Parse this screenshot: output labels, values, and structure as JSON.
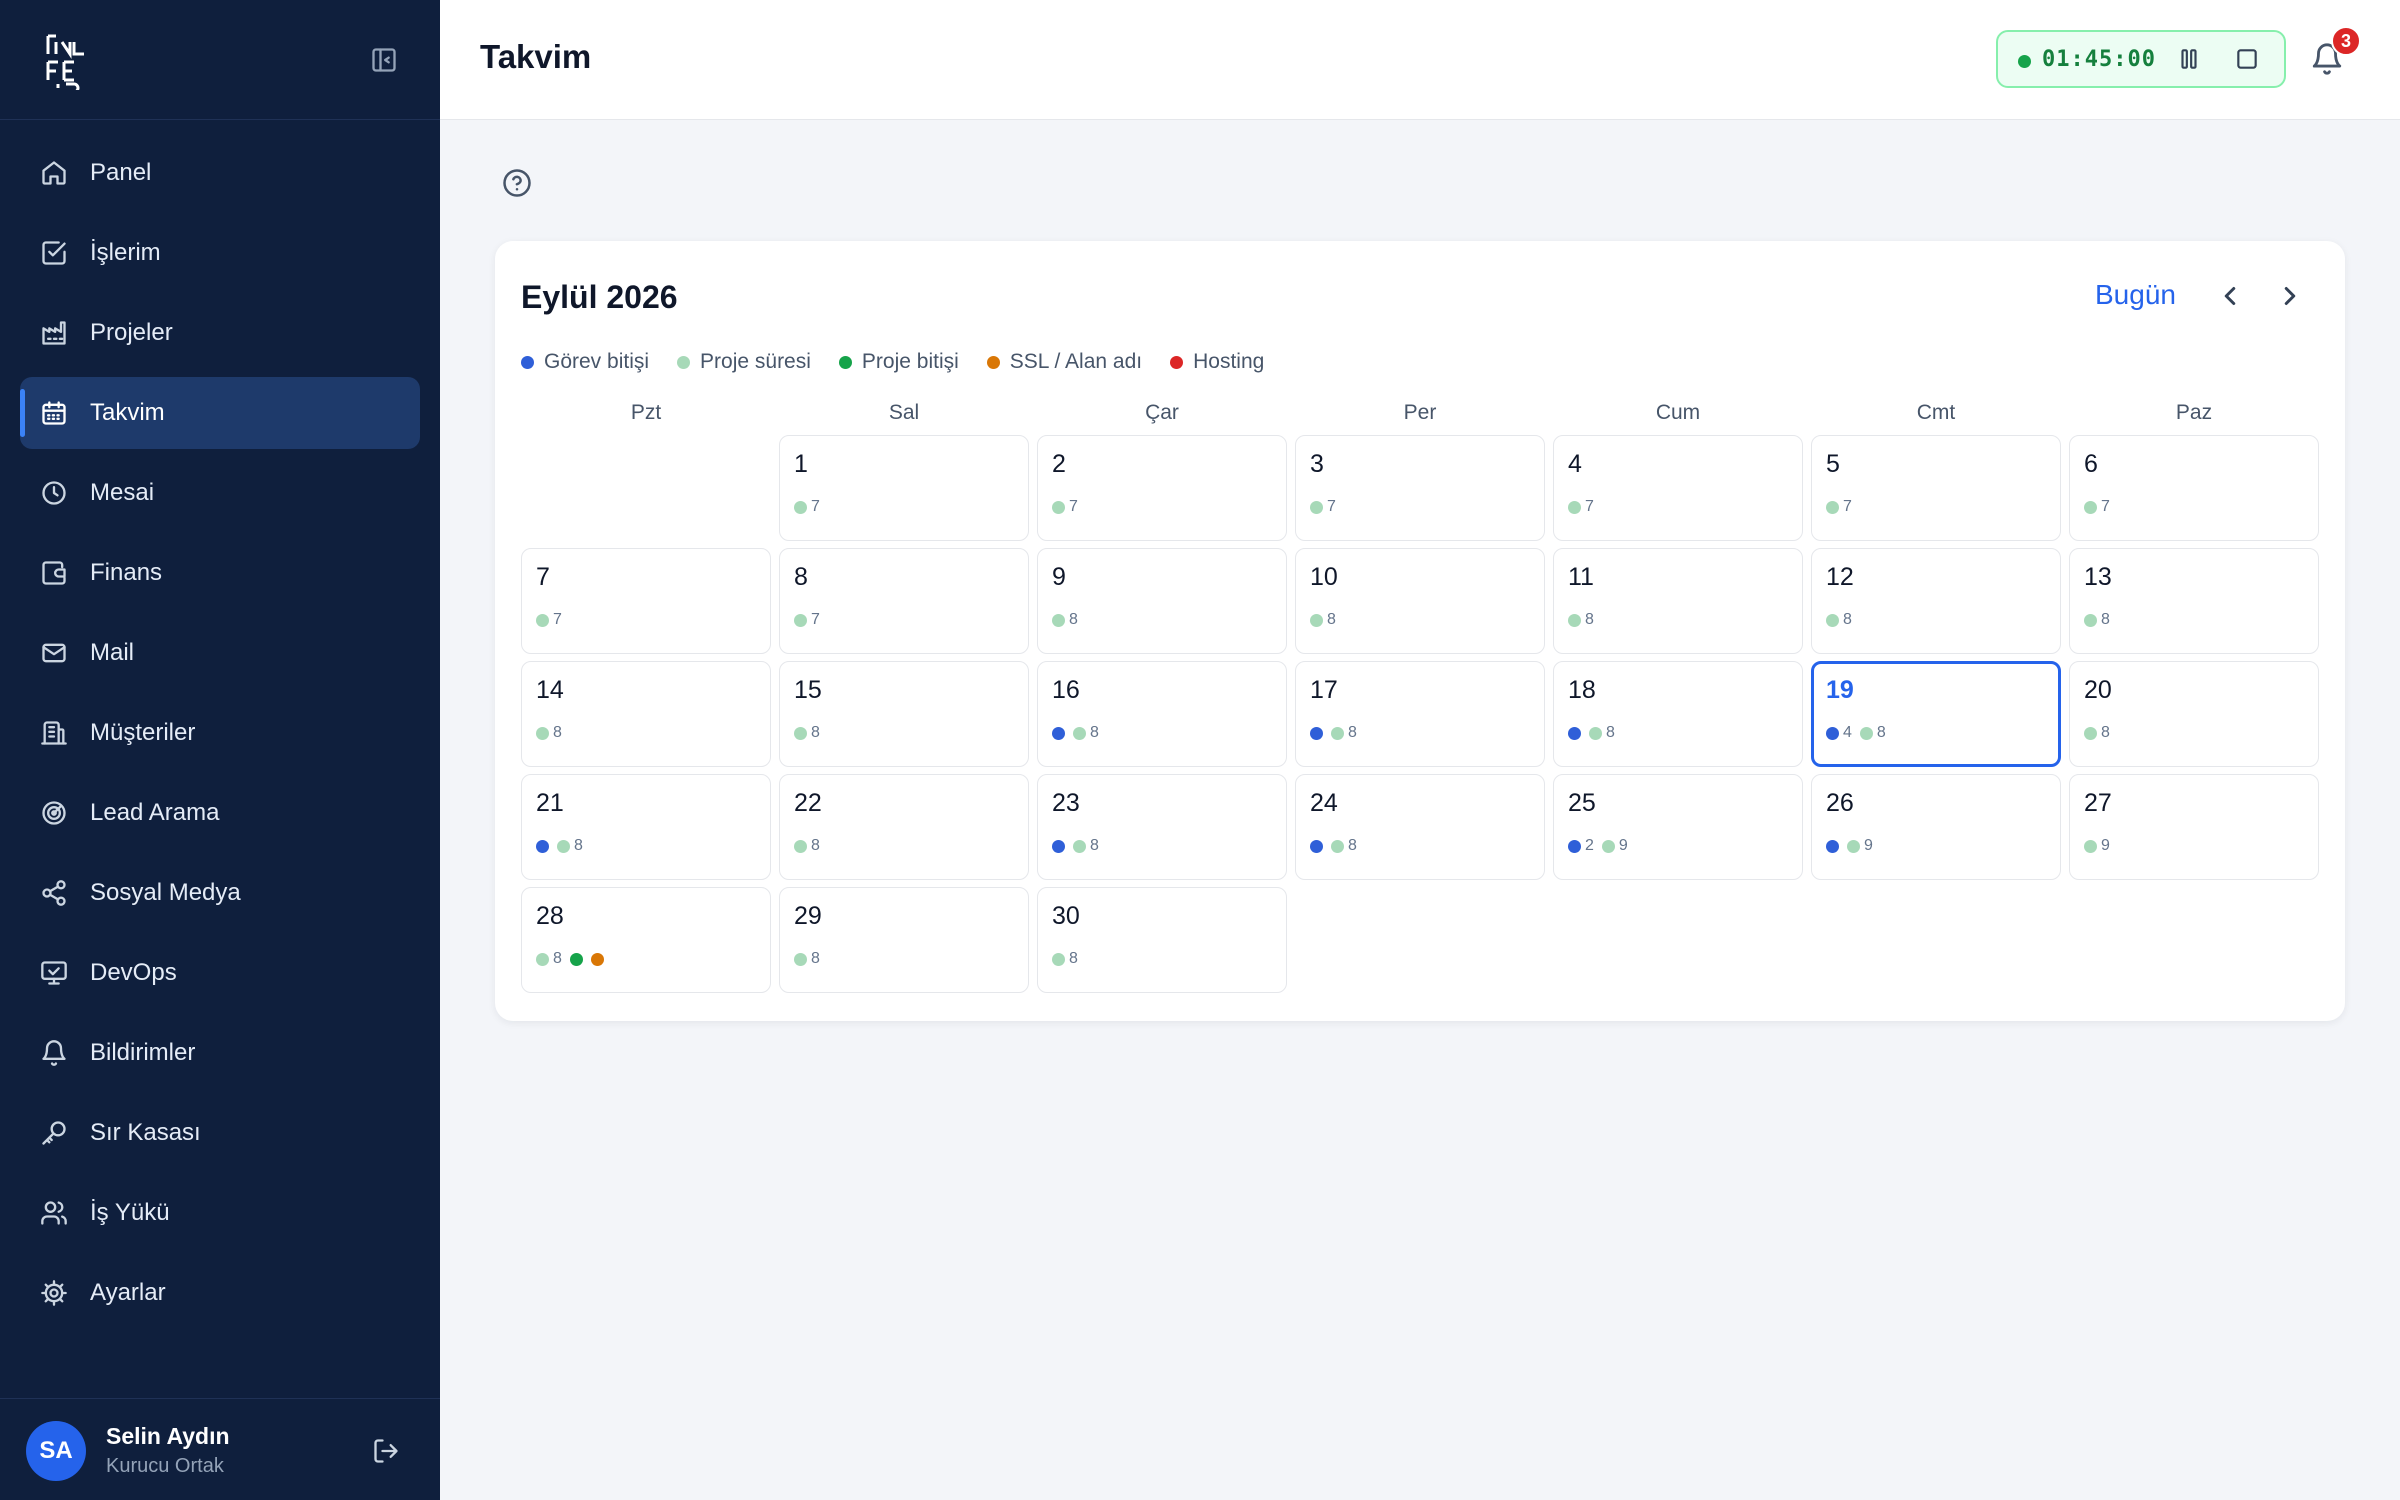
{
  "app": {
    "page_title": "Takvim"
  },
  "sidebar": {
    "items": [
      {
        "key": "panel",
        "label": "Panel",
        "icon": "home-icon"
      },
      {
        "key": "islerim",
        "label": "İşlerim",
        "icon": "check-square-icon"
      },
      {
        "key": "projeler",
        "label": "Projeler",
        "icon": "factory-icon"
      },
      {
        "key": "takvim",
        "label": "Takvim",
        "icon": "calendar-icon",
        "active": true
      },
      {
        "key": "mesai",
        "label": "Mesai",
        "icon": "clock-icon"
      },
      {
        "key": "finans",
        "label": "Finans",
        "icon": "wallet-icon"
      },
      {
        "key": "mail",
        "label": "Mail",
        "icon": "mail-icon"
      },
      {
        "key": "musteriler",
        "label": "Müşteriler",
        "icon": "building-icon"
      },
      {
        "key": "lead-arama",
        "label": "Lead Arama",
        "icon": "radar-icon"
      },
      {
        "key": "sosyal-medya",
        "label": "Sosyal Medya",
        "icon": "share-icon"
      },
      {
        "key": "devops",
        "label": "DevOps",
        "icon": "monitor-icon"
      },
      {
        "key": "bildirimler",
        "label": "Bildirimler",
        "icon": "bell-icon"
      },
      {
        "key": "sir-kasasi",
        "label": "Sır Kasası",
        "icon": "key-icon"
      },
      {
        "key": "is-yuku",
        "label": "İş Yükü",
        "icon": "users-icon"
      },
      {
        "key": "ayarlar",
        "label": "Ayarlar",
        "icon": "gear-icon"
      }
    ],
    "user": {
      "initials": "SA",
      "name": "Selin Aydın",
      "role": "Kurucu Ortak"
    }
  },
  "header": {
    "timer": "01:45:00",
    "notification_count": "3"
  },
  "calendar": {
    "month_title": "Eylül 2026",
    "today_label": "Bugün",
    "legend": [
      {
        "key": "gorev",
        "label": "Görev bitişi",
        "color": "#2f5fd8"
      },
      {
        "key": "proje-suresi",
        "label": "Proje süresi",
        "color": "#a7d9b8"
      },
      {
        "key": "proje-bitisi",
        "label": "Proje bitişi",
        "color": "#16a34a"
      },
      {
        "key": "ssl",
        "label": "SSL / Alan adı",
        "color": "#d97706"
      },
      {
        "key": "hosting",
        "label": "Hosting",
        "color": "#dc2626"
      }
    ],
    "weekdays": [
      "Pzt",
      "Sal",
      "Çar",
      "Per",
      "Cum",
      "Cmt",
      "Paz"
    ],
    "first_weekday_index": 1,
    "today": 19,
    "days": [
      {
        "d": 1,
        "ev": [
          [
            "proje-suresi",
            "7"
          ]
        ]
      },
      {
        "d": 2,
        "ev": [
          [
            "proje-suresi",
            "7"
          ]
        ]
      },
      {
        "d": 3,
        "ev": [
          [
            "proje-suresi",
            "7"
          ]
        ]
      },
      {
        "d": 4,
        "ev": [
          [
            "proje-suresi",
            "7"
          ]
        ]
      },
      {
        "d": 5,
        "ev": [
          [
            "proje-suresi",
            "7"
          ]
        ]
      },
      {
        "d": 6,
        "ev": [
          [
            "proje-suresi",
            "7"
          ]
        ]
      },
      {
        "d": 7,
        "ev": [
          [
            "proje-suresi",
            "7"
          ]
        ]
      },
      {
        "d": 8,
        "ev": [
          [
            "proje-suresi",
            "7"
          ]
        ]
      },
      {
        "d": 9,
        "ev": [
          [
            "proje-suresi",
            "8"
          ]
        ]
      },
      {
        "d": 10,
        "ev": [
          [
            "proje-suresi",
            "8"
          ]
        ]
      },
      {
        "d": 11,
        "ev": [
          [
            "proje-suresi",
            "8"
          ]
        ]
      },
      {
        "d": 12,
        "ev": [
          [
            "proje-suresi",
            "8"
          ]
        ]
      },
      {
        "d": 13,
        "ev": [
          [
            "proje-suresi",
            "8"
          ]
        ]
      },
      {
        "d": 14,
        "ev": [
          [
            "proje-suresi",
            "8"
          ]
        ]
      },
      {
        "d": 15,
        "ev": [
          [
            "proje-suresi",
            "8"
          ]
        ]
      },
      {
        "d": 16,
        "ev": [
          [
            "gorev",
            ""
          ],
          [
            "proje-suresi",
            "8"
          ]
        ]
      },
      {
        "d": 17,
        "ev": [
          [
            "gorev",
            ""
          ],
          [
            "proje-suresi",
            "8"
          ]
        ]
      },
      {
        "d": 18,
        "ev": [
          [
            "gorev",
            ""
          ],
          [
            "proje-suresi",
            "8"
          ]
        ]
      },
      {
        "d": 19,
        "ev": [
          [
            "gorev",
            "4"
          ],
          [
            "proje-suresi",
            "8"
          ]
        ]
      },
      {
        "d": 20,
        "ev": [
          [
            "proje-suresi",
            "8"
          ]
        ]
      },
      {
        "d": 21,
        "ev": [
          [
            "gorev",
            ""
          ],
          [
            "proje-suresi",
            "8"
          ]
        ]
      },
      {
        "d": 22,
        "ev": [
          [
            "proje-suresi",
            "8"
          ]
        ]
      },
      {
        "d": 23,
        "ev": [
          [
            "gorev",
            ""
          ],
          [
            "proje-suresi",
            "8"
          ]
        ]
      },
      {
        "d": 24,
        "ev": [
          [
            "gorev",
            ""
          ],
          [
            "proje-suresi",
            "8"
          ]
        ]
      },
      {
        "d": 25,
        "ev": [
          [
            "gorev",
            "2"
          ],
          [
            "proje-suresi",
            "9"
          ]
        ]
      },
      {
        "d": 26,
        "ev": [
          [
            "gorev",
            ""
          ],
          [
            "proje-suresi",
            "9"
          ]
        ]
      },
      {
        "d": 27,
        "ev": [
          [
            "proje-suresi",
            "9"
          ]
        ]
      },
      {
        "d": 28,
        "ev": [
          [
            "proje-suresi",
            "8"
          ],
          [
            "proje-bitisi",
            ""
          ],
          [
            "ssl",
            ""
          ]
        ]
      },
      {
        "d": 29,
        "ev": [
          [
            "proje-suresi",
            "8"
          ]
        ]
      },
      {
        "d": 30,
        "ev": [
          [
            "proje-suresi",
            "8"
          ]
        ]
      }
    ]
  }
}
